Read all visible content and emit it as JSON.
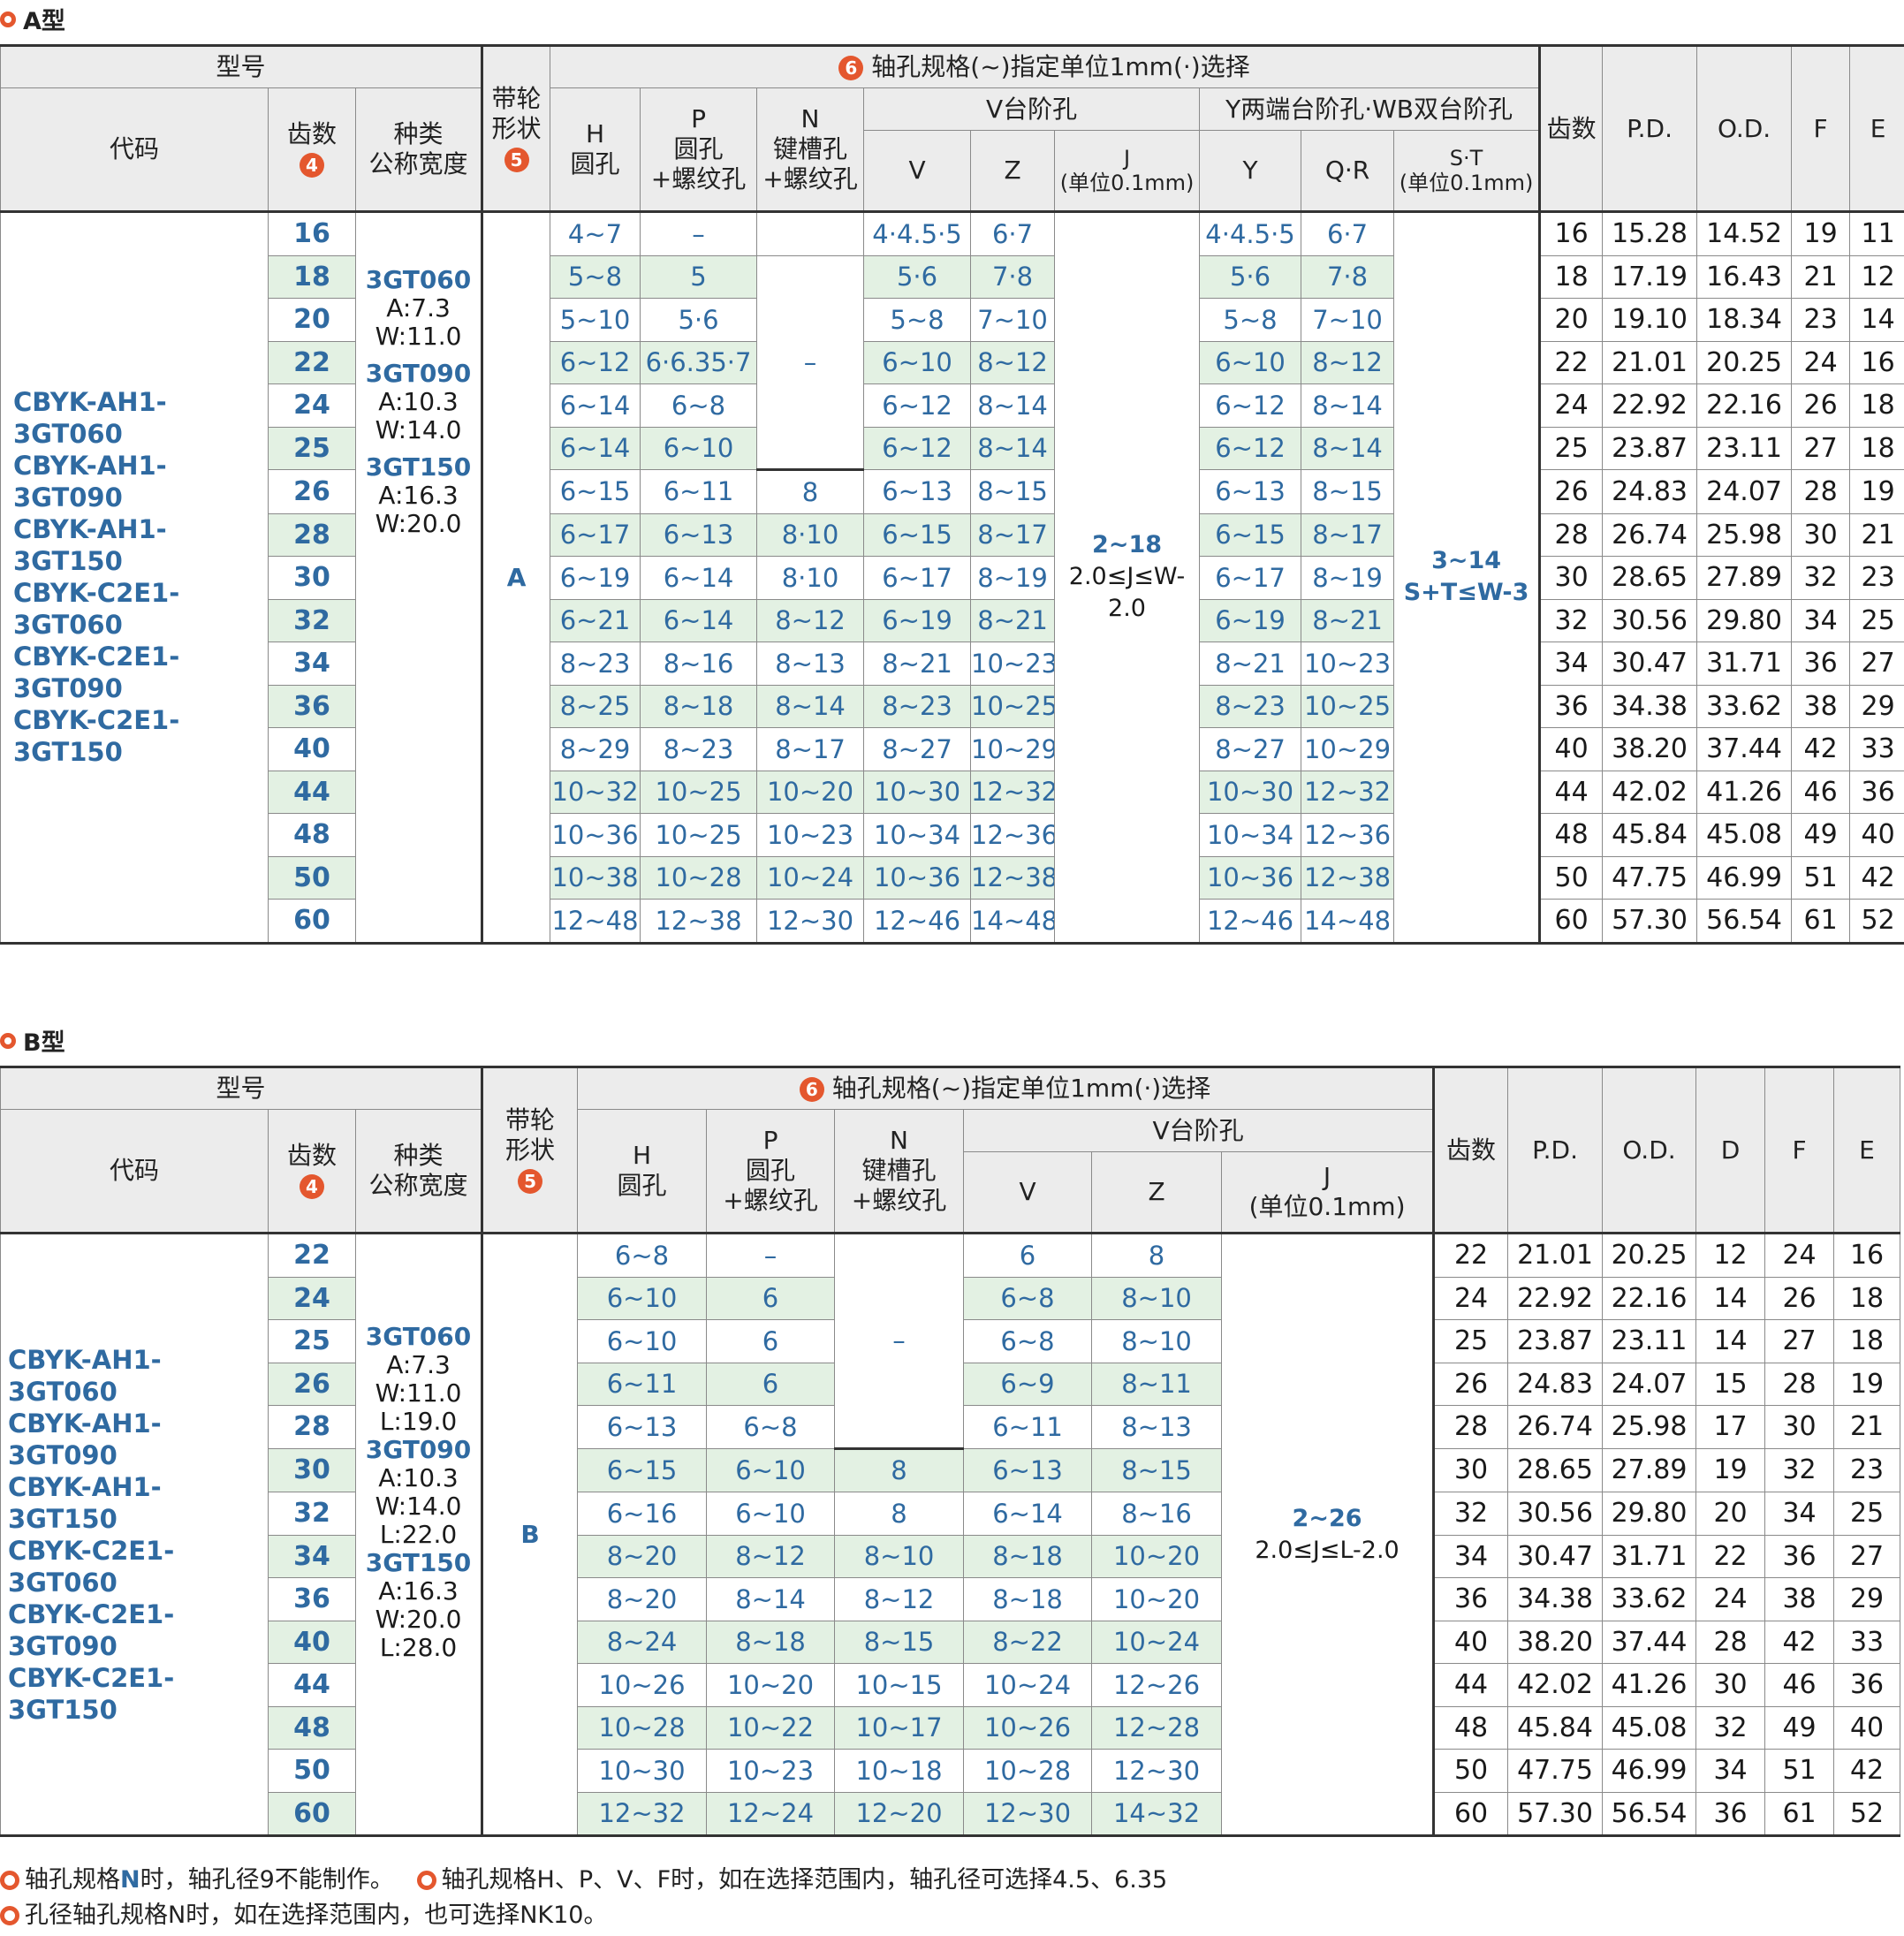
{
  "typeA": {
    "title": "A型",
    "hdr": {
      "model": "型号",
      "shaft_spec": "轴孔规格(~)指定单位1mm(·)选择",
      "code": "代码",
      "teeth": "齿数",
      "kind1": "种类",
      "kind2": "公称宽度",
      "shape1": "带轮",
      "shape2": "形状",
      "H1": "H",
      "H2": "圆孔",
      "P1": "P",
      "P2": "圆孔",
      "P3": "+螺纹孔",
      "N1": "N",
      "N2": "键槽孔",
      "N3": "+螺纹孔",
      "Vgroup": "V台阶孔",
      "Ygroup": "Y两端台阶孔·WB双台阶孔",
      "V": "V",
      "Z": "Z",
      "J1": "J",
      "J2": "(单位0.1mm)",
      "Y": "Y",
      "QR": "Q·R",
      "ST1": "S·T",
      "ST2": "(单位0.1mm)",
      "teeth2": "齿数",
      "PD": "P.D.",
      "OD": "O.D.",
      "F": "F",
      "E": "E",
      "badge4": "4",
      "badge5": "5",
      "badge6": "6"
    },
    "code": "CBYK-AH1-3GT060\nCBYK-AH1-3GT090\nCBYK-AH1-3GT150\nCBYK-C2E1-3GT060\nCBYK-C2E1-3GT090\nCBYK-C2E1-3GT150",
    "kinds": [
      {
        "name": "3GT060",
        "a": "A:7.3",
        "w": "W:11.0"
      },
      {
        "name": "3GT090",
        "a": "A:10.3",
        "w": "W:14.0"
      },
      {
        "name": "3GT150",
        "a": "A:16.3",
        "w": "W:20.0"
      }
    ],
    "shape": "A",
    "N_dash": "–",
    "J_range": "2~18",
    "J_cond1": "2.0≤J≤W-",
    "J_cond2": "2.0",
    "ST_range": "3~14",
    "ST_cond": "S+T≤W-3",
    "rows": [
      {
        "t": "16",
        "H": "4~7",
        "P": "–",
        "N": "",
        "V": "4·4.5·5",
        "Z": "6·7",
        "Y": "4·4.5·5",
        "QR": "6·7",
        "t2": "16",
        "PD": "15.28",
        "OD": "14.52",
        "F": "19",
        "E": "11"
      },
      {
        "t": "18",
        "H": "5~8",
        "P": "5",
        "N": "",
        "V": "5·6",
        "Z": "7·8",
        "Y": "5·6",
        "QR": "7·8",
        "t2": "18",
        "PD": "17.19",
        "OD": "16.43",
        "F": "21",
        "E": "12"
      },
      {
        "t": "20",
        "H": "5~10",
        "P": "5·6",
        "N": "",
        "V": "5~8",
        "Z": "7~10",
        "Y": "5~8",
        "QR": "7~10",
        "t2": "20",
        "PD": "19.10",
        "OD": "18.34",
        "F": "23",
        "E": "14"
      },
      {
        "t": "22",
        "H": "6~12",
        "P": "6·6.35·7",
        "N": "",
        "V": "6~10",
        "Z": "8~12",
        "Y": "6~10",
        "QR": "8~12",
        "t2": "22",
        "PD": "21.01",
        "OD": "20.25",
        "F": "24",
        "E": "16"
      },
      {
        "t": "24",
        "H": "6~14",
        "P": "6~8",
        "N": "",
        "V": "6~12",
        "Z": "8~14",
        "Y": "6~12",
        "QR": "8~14",
        "t2": "24",
        "PD": "22.92",
        "OD": "22.16",
        "F": "26",
        "E": "18"
      },
      {
        "t": "25",
        "H": "6~14",
        "P": "6~10",
        "N": "",
        "V": "6~12",
        "Z": "8~14",
        "Y": "6~12",
        "QR": "8~14",
        "t2": "25",
        "PD": "23.87",
        "OD": "23.11",
        "F": "27",
        "E": "18"
      },
      {
        "t": "26",
        "H": "6~15",
        "P": "6~11",
        "N": "8",
        "V": "6~13",
        "Z": "8~15",
        "Y": "6~13",
        "QR": "8~15",
        "t2": "26",
        "PD": "24.83",
        "OD": "24.07",
        "F": "28",
        "E": "19"
      },
      {
        "t": "28",
        "H": "6~17",
        "P": "6~13",
        "N": "8·10",
        "V": "6~15",
        "Z": "8~17",
        "Y": "6~15",
        "QR": "8~17",
        "t2": "28",
        "PD": "26.74",
        "OD": "25.98",
        "F": "30",
        "E": "21"
      },
      {
        "t": "30",
        "H": "6~19",
        "P": "6~14",
        "N": "8·10",
        "V": "6~17",
        "Z": "8~19",
        "Y": "6~17",
        "QR": "8~19",
        "t2": "30",
        "PD": "28.65",
        "OD": "27.89",
        "F": "32",
        "E": "23"
      },
      {
        "t": "32",
        "H": "6~21",
        "P": "6~14",
        "N": "8~12",
        "V": "6~19",
        "Z": "8~21",
        "Y": "6~19",
        "QR": "8~21",
        "t2": "32",
        "PD": "30.56",
        "OD": "29.80",
        "F": "34",
        "E": "25"
      },
      {
        "t": "34",
        "H": "8~23",
        "P": "8~16",
        "N": "8~13",
        "V": "8~21",
        "Z": "10~23",
        "Y": "8~21",
        "QR": "10~23",
        "t2": "34",
        "PD": "30.47",
        "OD": "31.71",
        "F": "36",
        "E": "27"
      },
      {
        "t": "36",
        "H": "8~25",
        "P": "8~18",
        "N": "8~14",
        "V": "8~23",
        "Z": "10~25",
        "Y": "8~23",
        "QR": "10~25",
        "t2": "36",
        "PD": "34.38",
        "OD": "33.62",
        "F": "38",
        "E": "29"
      },
      {
        "t": "40",
        "H": "8~29",
        "P": "8~23",
        "N": "8~17",
        "V": "8~27",
        "Z": "10~29",
        "Y": "8~27",
        "QR": "10~29",
        "t2": "40",
        "PD": "38.20",
        "OD": "37.44",
        "F": "42",
        "E": "33"
      },
      {
        "t": "44",
        "H": "10~32",
        "P": "10~25",
        "N": "10~20",
        "V": "10~30",
        "Z": "12~32",
        "Y": "10~30",
        "QR": "12~32",
        "t2": "44",
        "PD": "42.02",
        "OD": "41.26",
        "F": "46",
        "E": "36"
      },
      {
        "t": "48",
        "H": "10~36",
        "P": "10~25",
        "N": "10~23",
        "V": "10~34",
        "Z": "12~36",
        "Y": "10~34",
        "QR": "12~36",
        "t2": "48",
        "PD": "45.84",
        "OD": "45.08",
        "F": "49",
        "E": "40"
      },
      {
        "t": "50",
        "H": "10~38",
        "P": "10~28",
        "N": "10~24",
        "V": "10~36",
        "Z": "12~38",
        "Y": "10~36",
        "QR": "12~38",
        "t2": "50",
        "PD": "47.75",
        "OD": "46.99",
        "F": "51",
        "E": "42"
      },
      {
        "t": "60",
        "H": "12~48",
        "P": "12~38",
        "N": "12~30",
        "V": "12~46",
        "Z": "14~48",
        "Y": "12~46",
        "QR": "14~48",
        "t2": "60",
        "PD": "57.30",
        "OD": "56.54",
        "F": "61",
        "E": "52"
      }
    ]
  },
  "typeB": {
    "title": "B型",
    "hdr": {
      "model": "型号",
      "shaft_spec": "轴孔规格(~)指定单位1mm(·)选择",
      "code": "代码",
      "teeth": "齿数",
      "kind1": "种类",
      "kind2": "公称宽度",
      "shape1": "带轮",
      "shape2": "形状",
      "H1": "H",
      "H2": "圆孔",
      "P1": "P",
      "P2": "圆孔",
      "P3": "+螺纹孔",
      "N1": "N",
      "N2": "键槽孔",
      "N3": "+螺纹孔",
      "Vgroup": "V台阶孔",
      "V": "V",
      "Z": "Z",
      "J1": "J",
      "J2": "(单位0.1mm)",
      "teeth2": "齿数",
      "PD": "P.D.",
      "OD": "O.D.",
      "D": "D",
      "F": "F",
      "E": "E",
      "badge4": "4",
      "badge5": "5",
      "badge6": "6"
    },
    "code": "CBYK-AH1-3GT060\nCBYK-AH1-3GT090\nCBYK-AH1-3GT150\nCBYK-C2E1-3GT060\nCBYK-C2E1-3GT090\nCBYK-C2E1-3GT150",
    "kinds": [
      {
        "name": "3GT060",
        "a": "A:7.3",
        "w": "W:11.0",
        "l": "L:19.0"
      },
      {
        "name": "3GT090",
        "a": "A:10.3",
        "w": "W:14.0",
        "l": "L:22.0"
      },
      {
        "name": "3GT150",
        "a": "A:16.3",
        "w": "W:20.0",
        "l": "L:28.0"
      }
    ],
    "shape": "B",
    "N_dash": "–",
    "J_range": "2~26",
    "J_cond": "2.0≤J≤L-2.0",
    "rows": [
      {
        "t": "22",
        "H": "6~8",
        "P": "–",
        "N": "",
        "V": "6",
        "Z": "8",
        "t2": "22",
        "PD": "21.01",
        "OD": "20.25",
        "D": "12",
        "F": "24",
        "E": "16"
      },
      {
        "t": "24",
        "H": "6~10",
        "P": "6",
        "N": "",
        "V": "6~8",
        "Z": "8~10",
        "t2": "24",
        "PD": "22.92",
        "OD": "22.16",
        "D": "14",
        "F": "26",
        "E": "18"
      },
      {
        "t": "25",
        "H": "6~10",
        "P": "6",
        "N": "",
        "V": "6~8",
        "Z": "8~10",
        "t2": "25",
        "PD": "23.87",
        "OD": "23.11",
        "D": "14",
        "F": "27",
        "E": "18"
      },
      {
        "t": "26",
        "H": "6~11",
        "P": "6",
        "N": "",
        "V": "6~9",
        "Z": "8~11",
        "t2": "26",
        "PD": "24.83",
        "OD": "24.07",
        "D": "15",
        "F": "28",
        "E": "19"
      },
      {
        "t": "28",
        "H": "6~13",
        "P": "6~8",
        "N": "",
        "V": "6~11",
        "Z": "8~13",
        "t2": "28",
        "PD": "26.74",
        "OD": "25.98",
        "D": "17",
        "F": "30",
        "E": "21"
      },
      {
        "t": "30",
        "H": "6~15",
        "P": "6~10",
        "N": "8",
        "V": "6~13",
        "Z": "8~15",
        "t2": "30",
        "PD": "28.65",
        "OD": "27.89",
        "D": "19",
        "F": "32",
        "E": "23"
      },
      {
        "t": "32",
        "H": "6~16",
        "P": "6~10",
        "N": "8",
        "V": "6~14",
        "Z": "8~16",
        "t2": "32",
        "PD": "30.56",
        "OD": "29.80",
        "D": "20",
        "F": "34",
        "E": "25"
      },
      {
        "t": "34",
        "H": "8~20",
        "P": "8~12",
        "N": "8~10",
        "V": "8~18",
        "Z": "10~20",
        "t2": "34",
        "PD": "30.47",
        "OD": "31.71",
        "D": "22",
        "F": "36",
        "E": "27"
      },
      {
        "t": "36",
        "H": "8~20",
        "P": "8~14",
        "N": "8~12",
        "V": "8~18",
        "Z": "10~20",
        "t2": "36",
        "PD": "34.38",
        "OD": "33.62",
        "D": "24",
        "F": "38",
        "E": "29"
      },
      {
        "t": "40",
        "H": "8~24",
        "P": "8~18",
        "N": "8~15",
        "V": "8~22",
        "Z": "10~24",
        "t2": "40",
        "PD": "38.20",
        "OD": "37.44",
        "D": "28",
        "F": "42",
        "E": "33"
      },
      {
        "t": "44",
        "H": "10~26",
        "P": "10~20",
        "N": "10~15",
        "V": "10~24",
        "Z": "12~26",
        "t2": "44",
        "PD": "42.02",
        "OD": "41.26",
        "D": "30",
        "F": "46",
        "E": "36"
      },
      {
        "t": "48",
        "H": "10~28",
        "P": "10~22",
        "N": "10~17",
        "V": "10~26",
        "Z": "12~28",
        "t2": "48",
        "PD": "45.84",
        "OD": "45.08",
        "D": "32",
        "F": "49",
        "E": "40"
      },
      {
        "t": "50",
        "H": "10~30",
        "P": "10~23",
        "N": "10~18",
        "V": "10~28",
        "Z": "12~30",
        "t2": "50",
        "PD": "47.75",
        "OD": "46.99",
        "D": "34",
        "F": "51",
        "E": "42"
      },
      {
        "t": "60",
        "H": "12~32",
        "P": "12~24",
        "N": "12~20",
        "V": "12~30",
        "Z": "14~32",
        "t2": "60",
        "PD": "57.30",
        "OD": "56.54",
        "D": "36",
        "F": "61",
        "E": "52"
      }
    ]
  },
  "notes": {
    "n1a": "轴孔规格",
    "n1b": "N",
    "n1c": "时，轴孔径9不能制作。",
    "n2": "轴孔规格H、P、V、F时，如在选择范围内，轴孔径可选择4.5、6.35",
    "n3": "孔径轴孔规格N时，如在选择范围内，也可选择NK10。"
  }
}
